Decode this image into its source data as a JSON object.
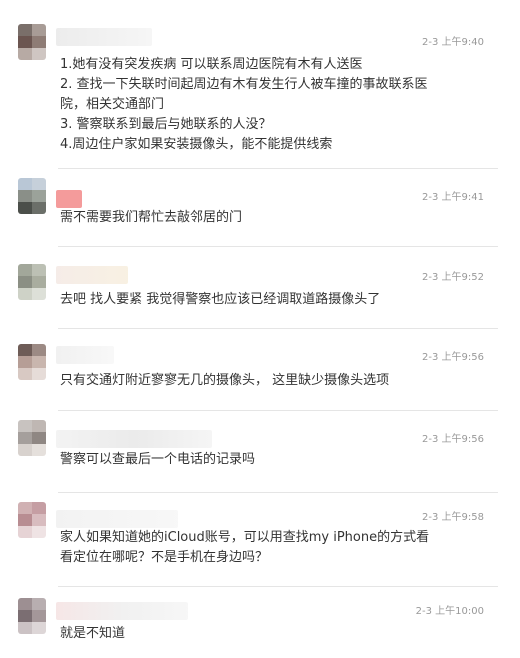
{
  "comments": [
    {
      "time": "2-3 上午9:40",
      "lines": [
        "1.她有没有突发疾病  可以联系周边医院有木有人送医",
        "2. 查找一下失联时间起周边有木有发生行人被车撞的事故联系医",
        "院，相关交通部门",
        "3. 警察联系到最后与她联系的人没？",
        "4.周边住户家如果安装摄像头，能不能提供线索"
      ]
    },
    {
      "time": "2-3 上午9:41",
      "lines": [
        "需不需要我们帮忙去敲邻居的门"
      ]
    },
    {
      "time": "2-3 上午9:52",
      "lines": [
        "去吧 找人要紧 我觉得警察也应该已经调取道路摄像头了"
      ]
    },
    {
      "time": "2-3 上午9:56",
      "lines": [
        "只有交通灯附近寥寥无几的摄像头， 这里缺少摄像头选项"
      ]
    },
    {
      "time": "2-3 上午9:56",
      "lines": [
        "警察可以查最后一个电话的记录吗"
      ]
    },
    {
      "time": "2-3 上午9:58",
      "lines": [
        "家人如果知道她的iCloud账号，可以用查找my iPhone的方式看",
        "看定位在哪呢？不是手机在身边吗？"
      ]
    },
    {
      "time": "2-3 上午10:00",
      "lines": [
        "就是不知道"
      ]
    }
  ],
  "colors": {
    "time": "#999999",
    "text": "#333333",
    "divider": "#e5e5e5"
  }
}
